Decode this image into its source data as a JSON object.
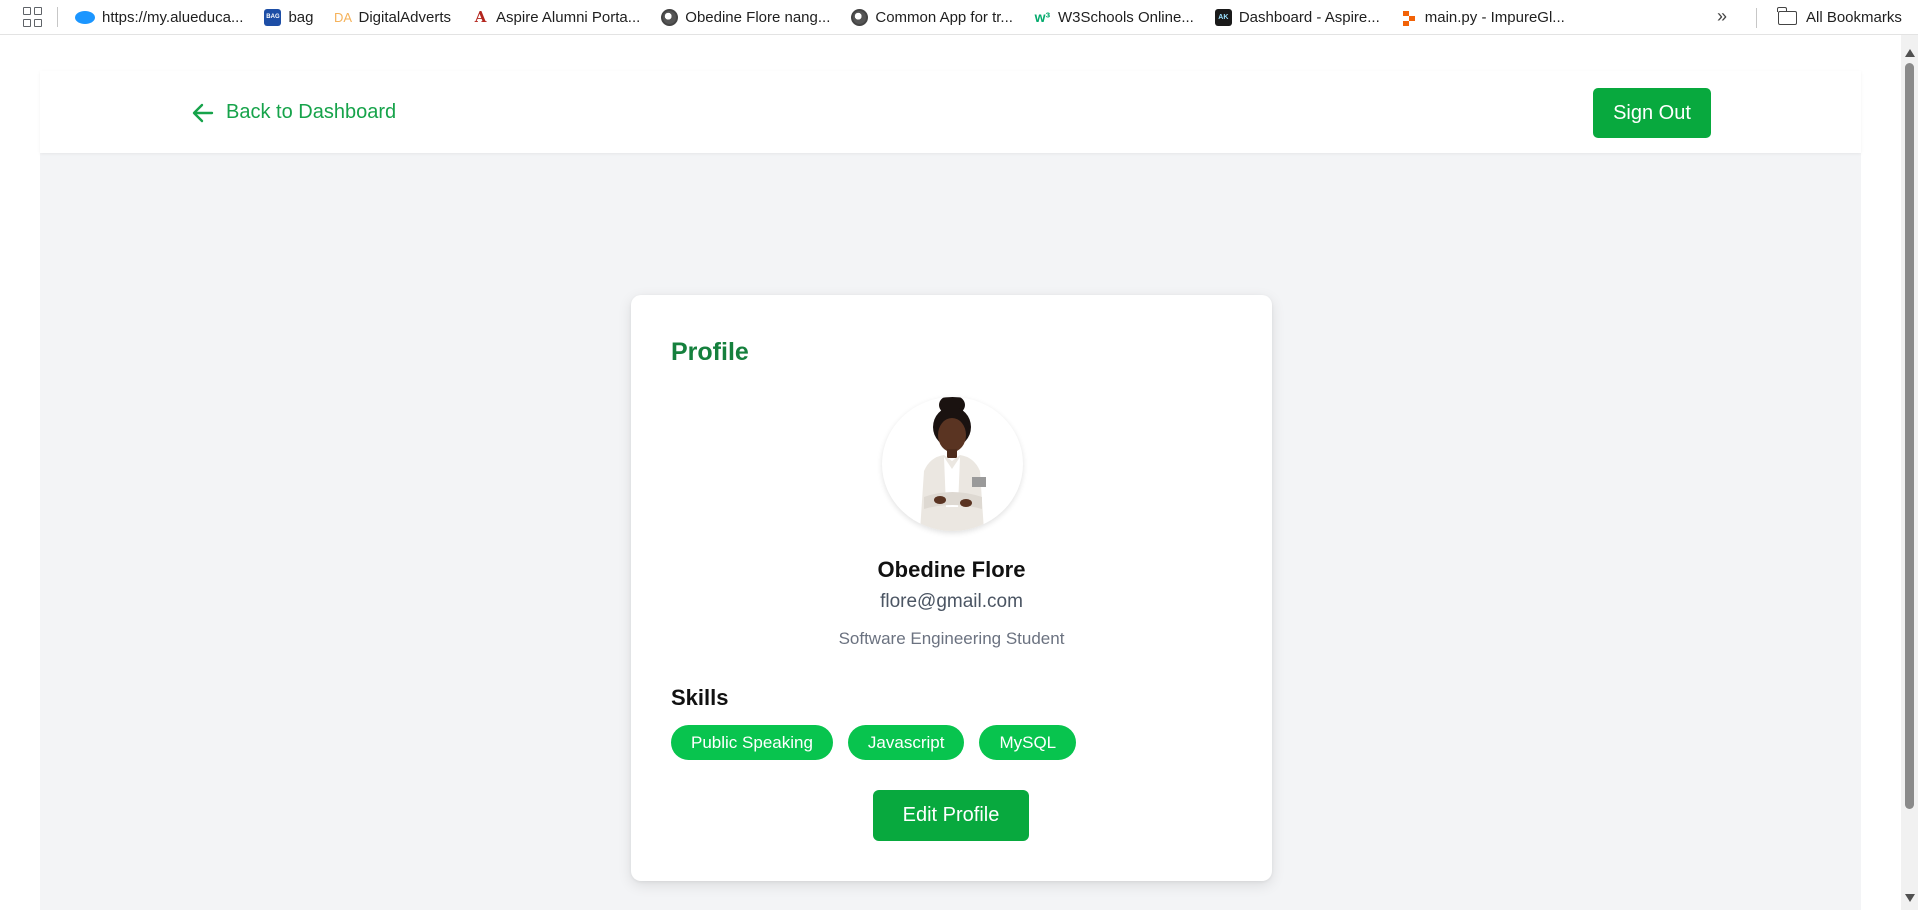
{
  "bookmarks": {
    "items": [
      {
        "label": "https://my.alueduca...",
        "icon": "cloud-icon"
      },
      {
        "label": "bag",
        "icon": "bag-icon"
      },
      {
        "label": "DigitalAdverts",
        "icon": "da-icon"
      },
      {
        "label": "Aspire Alumni Porta...",
        "icon": "aspire-icon"
      },
      {
        "label": "Obedine Flore nang...",
        "icon": "globe-icon"
      },
      {
        "label": "Common App for tr...",
        "icon": "globe-icon"
      },
      {
        "label": "W3Schools Online...",
        "icon": "w3schools-icon"
      },
      {
        "label": "Dashboard - Aspire...",
        "icon": "aspire-dashboard-icon"
      },
      {
        "label": "main.py - ImpureGl...",
        "icon": "replit-icon"
      }
    ],
    "more": "»",
    "all_bookmarks": "All Bookmarks",
    "fav_text": {
      "bag": "BAG",
      "da": "DA",
      "a": "A",
      "w3": "w³",
      "ak": "AK"
    }
  },
  "header": {
    "back_label": "Back to Dashboard",
    "signout_label": "Sign Out"
  },
  "profile": {
    "title": "Profile",
    "name": "Obedine Flore",
    "email": "flore@gmail.com",
    "role": "Software Engineering Student",
    "skills_title": "Skills",
    "skills": [
      "Public Speaking",
      "Javascript",
      "MySQL"
    ],
    "edit_label": "Edit Profile"
  },
  "colors": {
    "accent": "#16a34a",
    "button": "#08a93e",
    "chip": "#08c44e",
    "background": "#f3f4f6"
  }
}
